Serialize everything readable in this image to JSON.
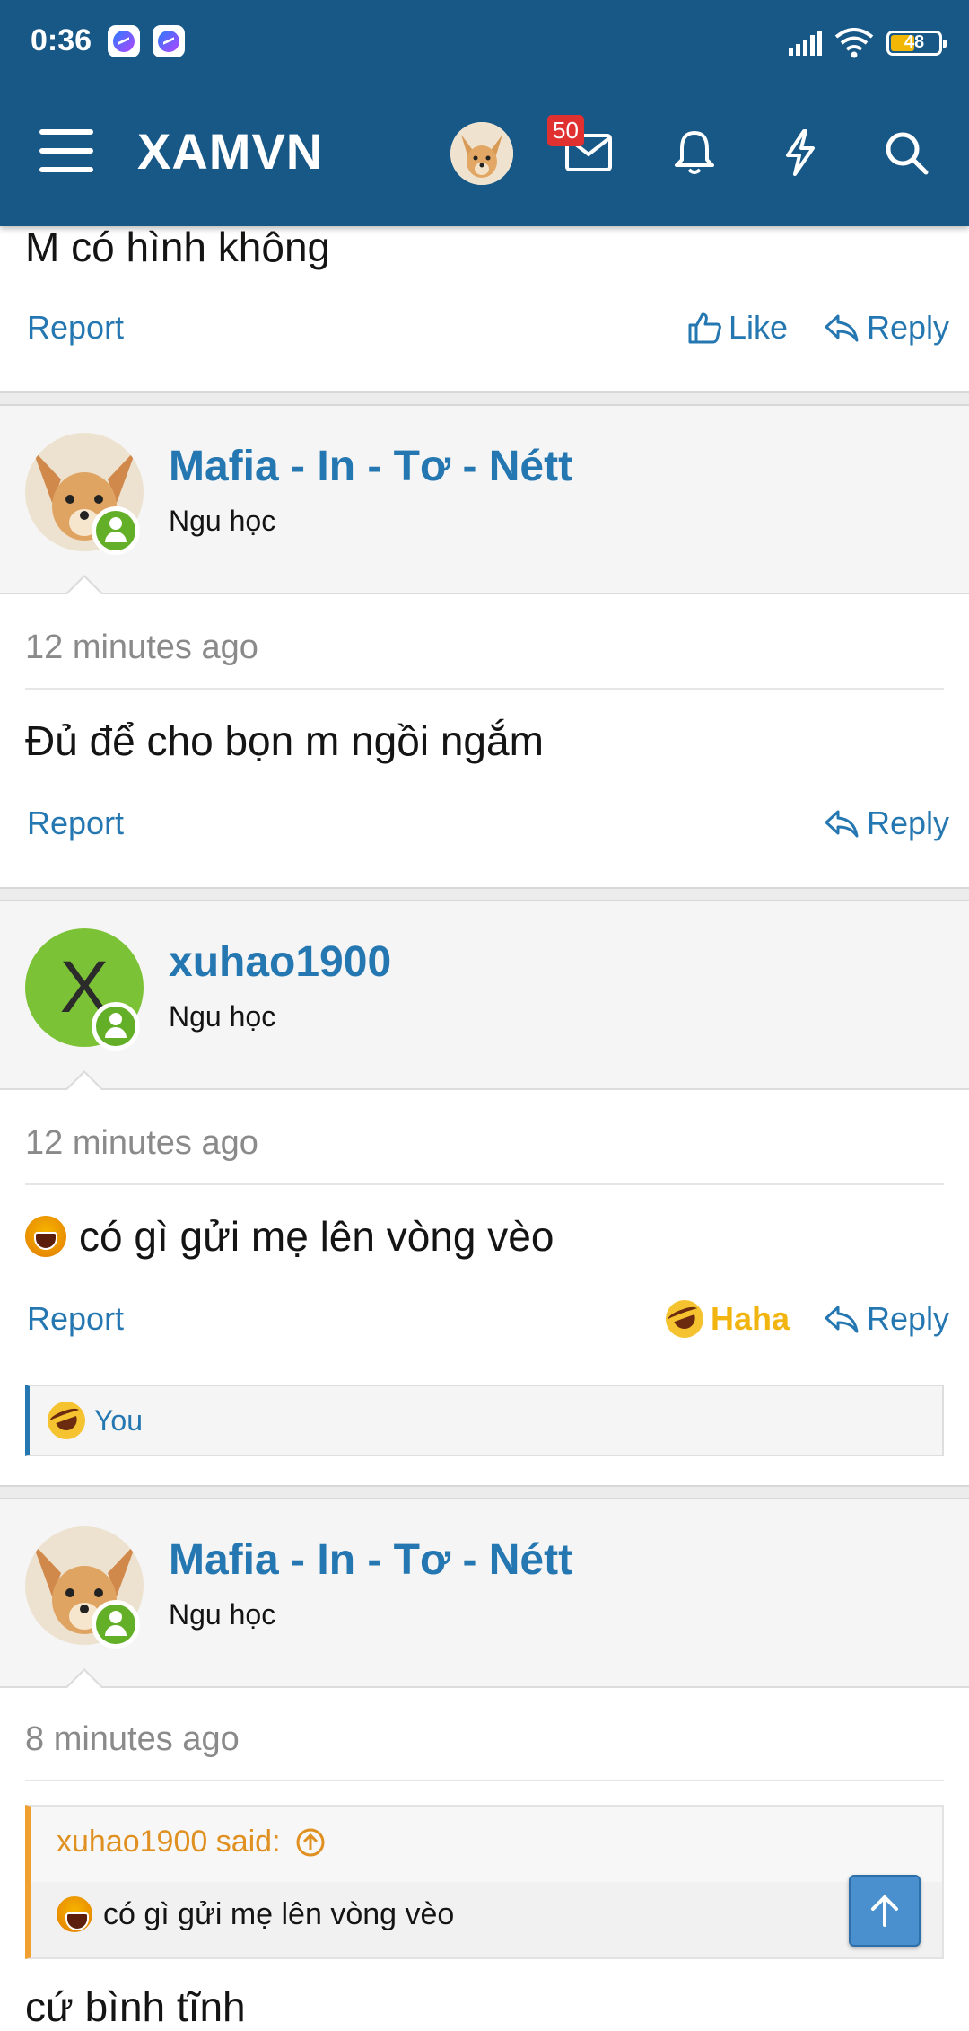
{
  "status_bar": {
    "time": "0:36",
    "battery": "48"
  },
  "header": {
    "brand": "XAMVN",
    "inbox_badge": "50"
  },
  "posts": [
    {
      "message": "M có hình không",
      "actions": {
        "report": "Report",
        "like": "Like",
        "reply": "Reply"
      }
    },
    {
      "username": "Mafia - In - Tơ - Nétt",
      "user_title": "Ngu học",
      "time": "12 minutes ago",
      "message": "Đủ để cho bọn m ngồi ngắm",
      "actions": {
        "report": "Report",
        "reply": "Reply"
      }
    },
    {
      "username": "xuhao1900",
      "avatar_letter": "X",
      "user_title": "Ngu học",
      "time": "12 minutes ago",
      "message": "có gì gửi mẹ lên vòng vèo",
      "actions": {
        "report": "Report",
        "reaction": "Haha",
        "reply": "Reply"
      },
      "reacted_by": "You"
    },
    {
      "username": "Mafia - In - Tơ - Nétt",
      "user_title": "Ngu học",
      "time": "8 minutes ago",
      "quote_author": "xuhao1900 said:",
      "quote_text": "có gì gửi mẹ lên vòng vèo",
      "message": "cứ bình tĩnh"
    }
  ],
  "colors": {
    "header": "#185887",
    "link": "#2577b1",
    "haha": "#f2b50f",
    "quote_accent": "#f0a030"
  }
}
